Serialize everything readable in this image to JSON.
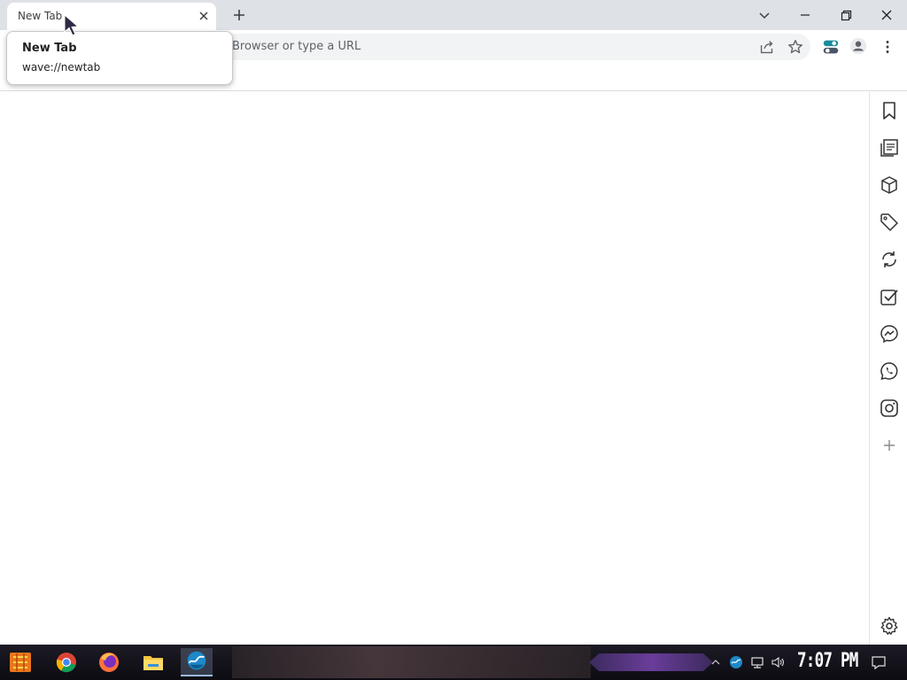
{
  "tab": {
    "title": "New Tab"
  },
  "tooltip": {
    "title": "New Tab",
    "url": "wave://newtab"
  },
  "omnibox": {
    "placeholder": "Browser or type a URL"
  },
  "sidebar": {
    "items": [
      {
        "icon": "bookmark-icon"
      },
      {
        "icon": "reading-list-icon"
      },
      {
        "icon": "box-icon"
      },
      {
        "icon": "tag-icon"
      },
      {
        "icon": "sync-icon"
      },
      {
        "icon": "task-check-icon"
      },
      {
        "icon": "messenger-icon"
      },
      {
        "icon": "whatsapp-icon"
      },
      {
        "icon": "instagram-icon"
      },
      {
        "icon": "add-icon"
      }
    ],
    "settings_icon": "gear-icon"
  },
  "taskbar": {
    "clock": "7:07 PM",
    "apps": [
      "start-icon",
      "chrome-icon",
      "firefox-icon",
      "file-explorer-icon",
      "wave-browser-icon"
    ]
  },
  "colors": {
    "tabstrip": "#dee1e6",
    "omnibox": "#f1f3f4",
    "taskbar": "#14121a"
  }
}
